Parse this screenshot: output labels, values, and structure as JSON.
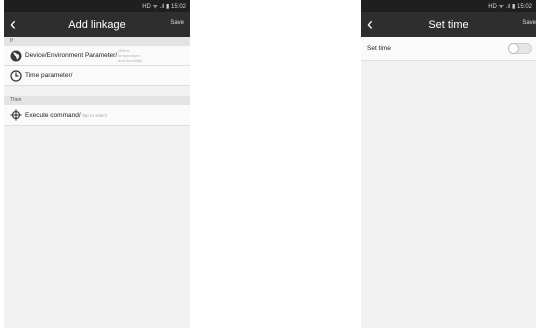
{
  "left": {
    "status_text": "HD ᯤ .ıl ▮ 15:02",
    "title": "Add linkage",
    "save_label": "Save",
    "if_label": "If",
    "device_label": "Device/Environment Parameter/",
    "device_hint_lines": [
      "(Either",
      "temperature",
      "and humidity)"
    ],
    "time_label": "Time parameter/",
    "then_label": "Then",
    "execute_label": "Execute command/",
    "execute_hint": "Tap to select"
  },
  "right": {
    "status_text": "HD ᯤ .ıl ▮ 15:02",
    "title": "Set time",
    "save_label": "Save",
    "set_time_label": "Set time",
    "set_time_enabled": false
  }
}
